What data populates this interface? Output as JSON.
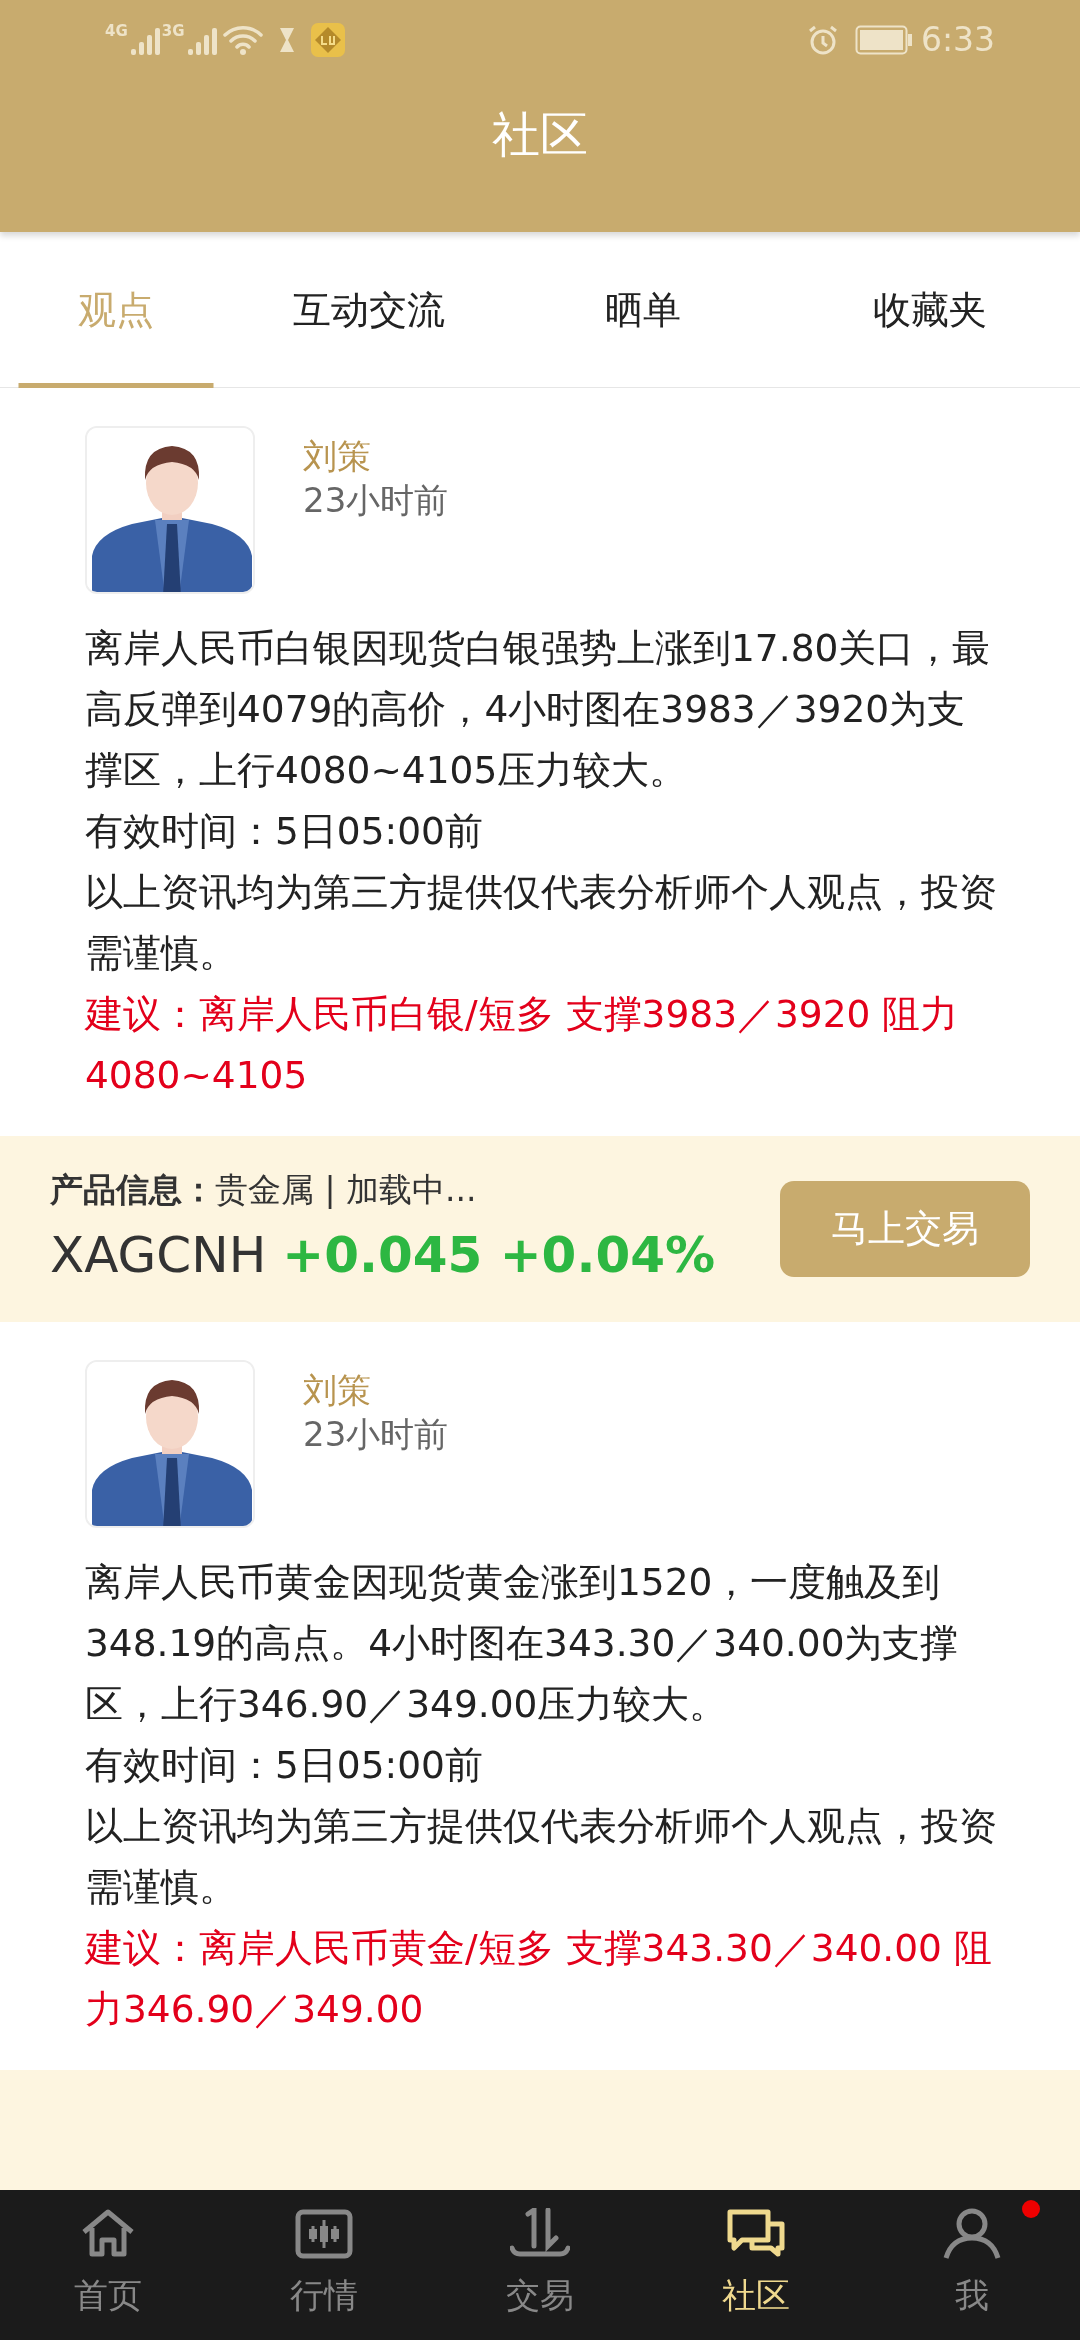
{
  "status_bar": {
    "networks": [
      "4G",
      "3G"
    ],
    "time": "6:33"
  },
  "header": {
    "title": "社区"
  },
  "tabs": [
    {
      "label": "观点",
      "selected": true
    },
    {
      "label": "互动交流",
      "selected": false
    },
    {
      "label": "晒单",
      "selected": false
    },
    {
      "label": "收藏夹",
      "selected": false
    }
  ],
  "posts": [
    {
      "author": "刘策",
      "time": "23小时前",
      "paragraphs": [
        "离岸人民币白银因现货白银强势上涨到17.80关口，最高反弹到4079的高价，4小时图在3983／3920为支撑区，上行4080~4105压力较大。",
        "有效时间：5日05:00前",
        "以上资讯均为第三方提供仅代表分析师个人观点，投资需谨慎。"
      ],
      "suggestion": "建议：离岸人民币白银/短多 支撑3983／3920 阻力4080~4105",
      "product": {
        "label": "产品信息：",
        "info": "贵金属 | 加载中...",
        "symbol": "XAGCNH",
        "change": "+0.045 +0.04%",
        "button": "马上交易"
      }
    },
    {
      "author": "刘策",
      "time": "23小时前",
      "paragraphs": [
        "离岸人民币黄金因现货黄金涨到1520，一度触及到348.19的高点。4小时图在343.30／340.00为支撑区，上行346.90／349.00压力较大。",
        "有效时间：5日05:00前",
        "以上资讯均为第三方提供仅代表分析师个人观点，投资需谨慎。"
      ],
      "suggestion": "建议：离岸人民币黄金/短多 支撑343.30／340.00 阻力346.90／349.00"
    }
  ],
  "bottom_nav": [
    {
      "label": "首页",
      "kind": "home",
      "selected": false,
      "badge": false
    },
    {
      "label": "行情",
      "kind": "market",
      "selected": false,
      "badge": false
    },
    {
      "label": "交易",
      "kind": "trade",
      "selected": false,
      "badge": false
    },
    {
      "label": "社区",
      "kind": "community",
      "selected": true,
      "badge": false
    },
    {
      "label": "我",
      "kind": "me",
      "selected": false,
      "badge": true
    }
  ]
}
